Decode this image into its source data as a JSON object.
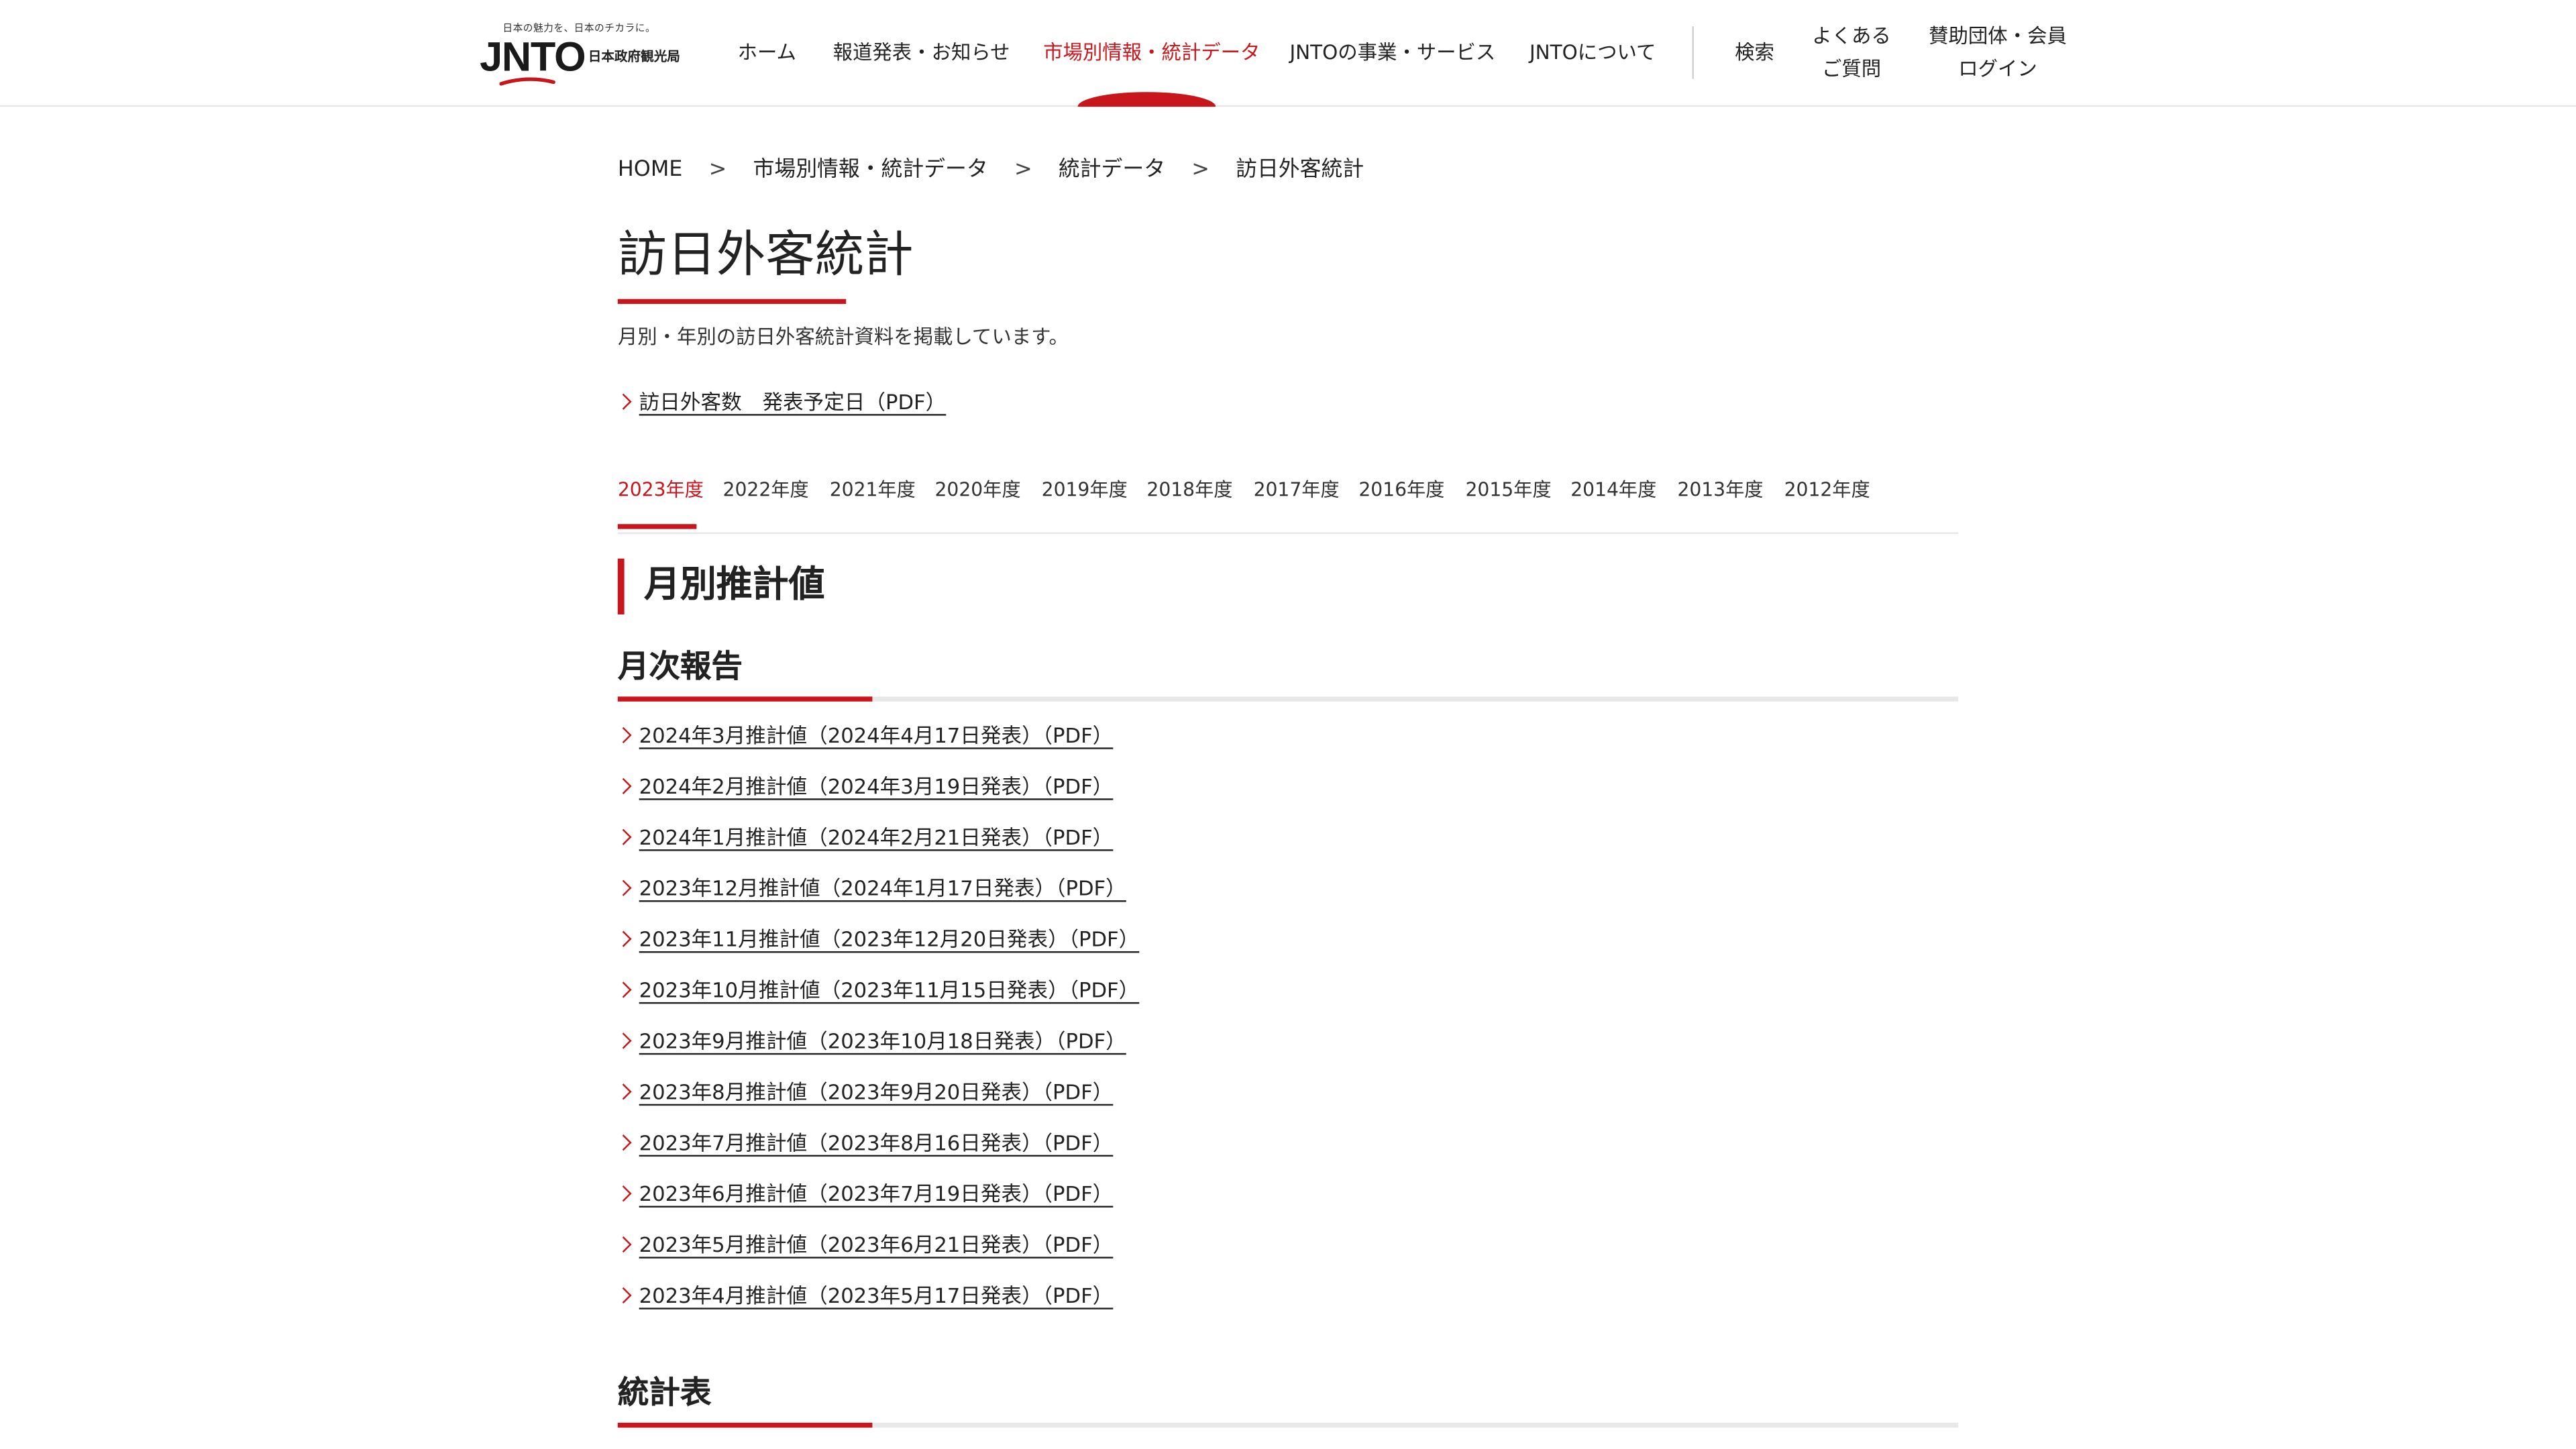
{
  "logo": {
    "tagline": "日本の魅力を、日本のチカラに。",
    "mark": "JNTO",
    "subtitle": "日本政府観光局",
    "brand_color": "#c8161d"
  },
  "nav": {
    "items": [
      {
        "label": "ホーム",
        "active": false
      },
      {
        "label": "報道発表・お知らせ",
        "active": false
      },
      {
        "label": "市場別情報・統計データ",
        "active": true
      },
      {
        "label": "JNTOの事業・サービス",
        "active": false
      },
      {
        "label": "JNTOについて",
        "active": false
      }
    ],
    "search": "検索",
    "faq_line1": "よくある",
    "faq_line2": "ご質問",
    "members_line1": "賛助団体・会員",
    "members_line2": "ログイン"
  },
  "breadcrumb": [
    {
      "label": "HOME"
    },
    {
      "label": "市場別情報・統計データ"
    },
    {
      "label": "統計データ"
    },
    {
      "label": "訪日外客統計"
    }
  ],
  "breadcrumb_separator": ">",
  "page": {
    "title": "訪日外客統計",
    "lead": "月別・年別の訪日外客統計資料を掲載しています。",
    "schedule_link": "訪日外客数　発表予定日（PDF）"
  },
  "year_tabs": [
    {
      "label": "2023年度",
      "active": true
    },
    {
      "label": "2022年度",
      "active": false
    },
    {
      "label": "2021年度",
      "active": false
    },
    {
      "label": "2020年度",
      "active": false
    },
    {
      "label": "2019年度",
      "active": false
    },
    {
      "label": "2018年度",
      "active": false
    },
    {
      "label": "2017年度",
      "active": false
    },
    {
      "label": "2016年度",
      "active": false
    },
    {
      "label": "2015年度",
      "active": false
    },
    {
      "label": "2014年度",
      "active": false
    },
    {
      "label": "2013年度",
      "active": false
    },
    {
      "label": "2012年度",
      "active": false
    }
  ],
  "section": {
    "title": "月別推計値",
    "monthly_report_title": "月次報告",
    "monthly_reports": [
      "2024年3月推計値（2024年4月17日発表）（PDF）",
      "2024年2月推計値（2024年3月19日発表）（PDF）",
      "2024年1月推計値（2024年2月21日発表）（PDF）",
      "2023年12月推計値（2024年1月17日発表）（PDF）",
      "2023年11月推計値（2023年12月20日発表）（PDF）",
      "2023年10月推計値（2023年11月15日発表）（PDF）",
      "2023年9月推計値（2023年10月18日発表）（PDF）",
      "2023年8月推計値（2023年9月20日発表）（PDF）",
      "2023年7月推計値（2023年8月16日発表）（PDF）",
      "2023年6月推計値（2023年7月19日発表）（PDF）",
      "2023年5月推計値（2023年6月21日発表）（PDF）",
      "2023年4月推計値（2023年5月17日発表）（PDF）"
    ],
    "stats_table_title": "統計表"
  }
}
